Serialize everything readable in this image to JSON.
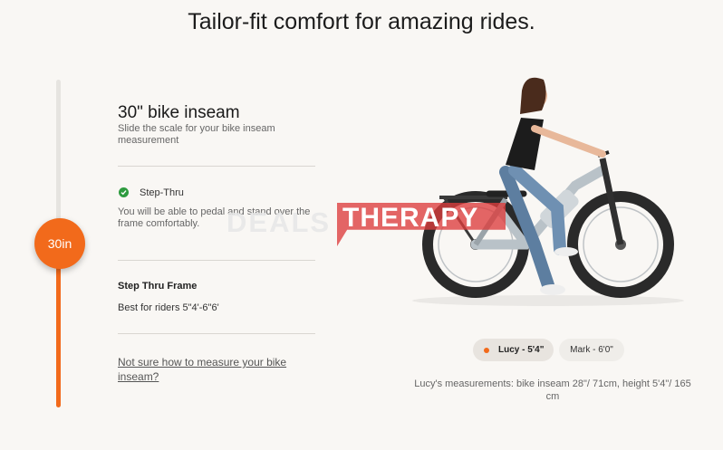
{
  "headline": "Tailor-fit comfort for amazing rides.",
  "slider": {
    "thumb_label": "30in",
    "level_fraction": 0.5
  },
  "inseam": {
    "title": "30\" bike inseam",
    "subtitle": "Slide the scale for your bike inseam measurement"
  },
  "frame": {
    "type": "Step-Thru",
    "description": "You will be able to pedal and stand over the frame comfortably.",
    "name": "Step Thru Frame",
    "riders": "Best for riders 5\"4'-6\"6'"
  },
  "measure_link": "Not sure how to measure your bike inseam?",
  "riders_toggle": {
    "options": [
      "Lucy - 5'4\"",
      "Mark - 6'0\""
    ],
    "selected": "Lucy - 5'4\""
  },
  "measurements": "Lucy's measurements: bike inseam 28\"/ 71cm, height 5'4\"/ 165 cm",
  "watermark": "DEALSTHERAPY",
  "colors": {
    "accent": "#f26a1b",
    "check": "#2e9b3f",
    "watermark_red": "#dc3c3c"
  },
  "icons": [
    "check-circle-icon",
    "orange-dot-icon"
  ]
}
